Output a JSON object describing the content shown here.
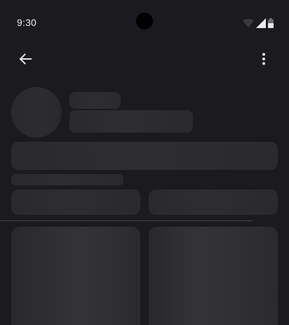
{
  "status_bar": {
    "time": "9:30",
    "icons": [
      "wifi-icon",
      "cellular-signal-icon",
      "battery-icon"
    ]
  },
  "app_bar": {
    "left_icon": "arrow-back-icon",
    "right_icon": "more-vert-icon"
  },
  "colors": {
    "background": "#1b1a1e",
    "skeleton": "#2a292d",
    "icon": "#e6e1e5",
    "divider": "#48464c"
  }
}
